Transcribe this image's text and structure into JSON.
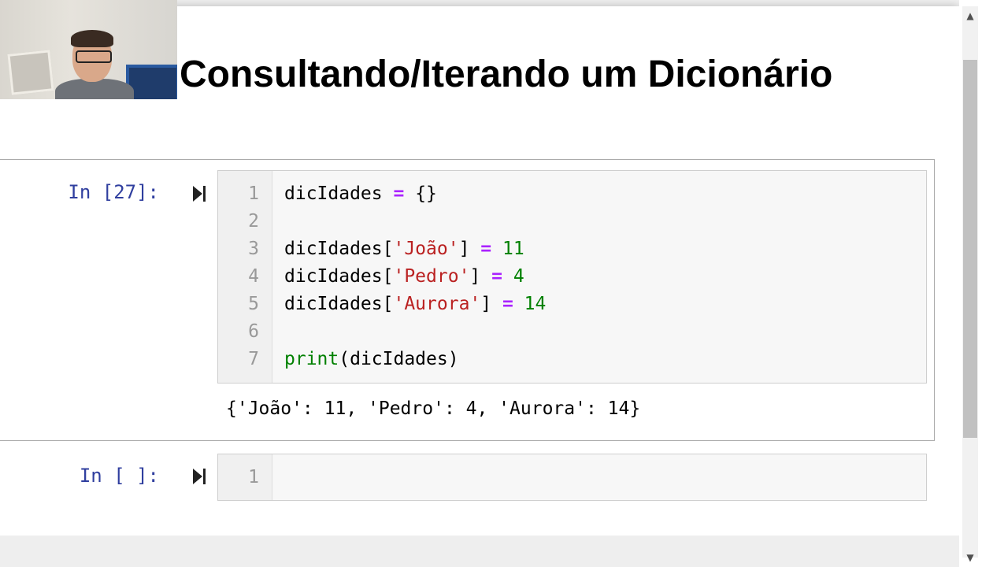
{
  "notebook": {
    "heading": "Consultando/Iterando um Dicionário",
    "cells": [
      {
        "prompt": "In [27]:",
        "lines": [
          {
            "n": "1"
          },
          {
            "n": "2"
          },
          {
            "n": "3"
          },
          {
            "n": "4"
          },
          {
            "n": "5"
          },
          {
            "n": "6"
          },
          {
            "n": "7"
          }
        ],
        "output": "{'João': 11, 'Pedro': 4, 'Aurora': 14}"
      },
      {
        "prompt": "In [ ]:",
        "lines": [
          {
            "n": "1"
          }
        ]
      }
    ]
  },
  "code": {
    "l1_var": "dicIdades ",
    "l1_op": "=",
    "l1_rest": " {}",
    "l3_var": "dicIdades[",
    "l3_str": "'João'",
    "l3_mid": "] ",
    "l3_op": "=",
    "l3_num": " 11",
    "l4_var": "dicIdades[",
    "l4_str": "'Pedro'",
    "l4_mid": "] ",
    "l4_op": "=",
    "l4_num": " 4",
    "l5_var": "dicIdades[",
    "l5_str": "'Aurora'",
    "l5_mid": "] ",
    "l5_op": "=",
    "l5_num": " 14",
    "l7_fn": "print",
    "l7_rest": "(dicIdades)"
  },
  "colors": {
    "prompt": "#303f9f",
    "operator": "#aa22ff",
    "string": "#ba2121",
    "number": "#008000",
    "builtin": "#008000"
  },
  "icons": {
    "run": "run-cell-icon",
    "scroll_up": "scroll-up-arrow-icon",
    "scroll_down": "scroll-down-arrow-icon"
  }
}
